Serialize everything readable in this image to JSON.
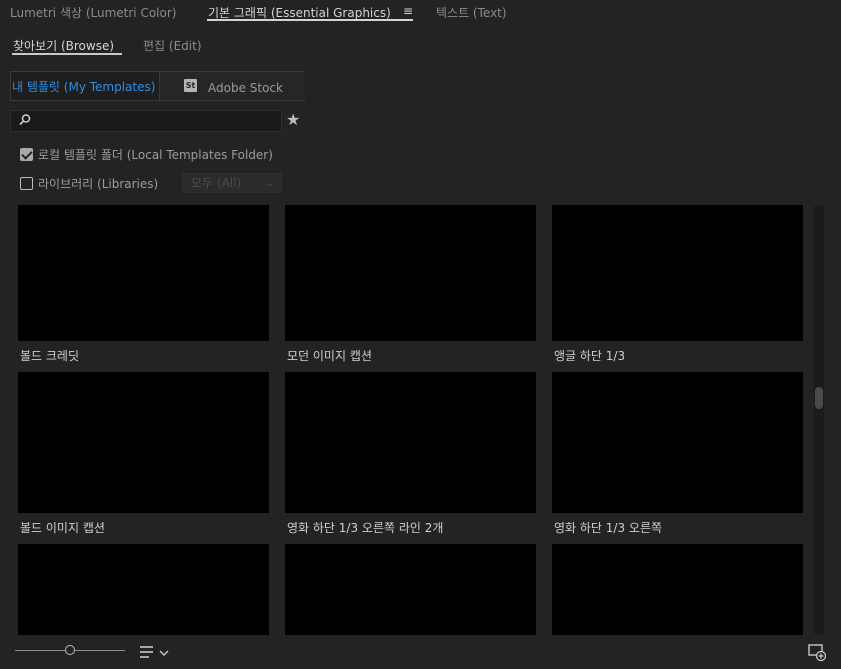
{
  "panel_tabs": [
    {
      "label": "Lumetri 색상 (Lumetri Color)",
      "active": false
    },
    {
      "label": "기본 그래픽 (Essential Graphics)",
      "active": true
    },
    {
      "label": "텍스트 (Text)",
      "active": false
    }
  ],
  "panel_menu_icon": "hamburger-menu-icon",
  "sub_tabs": [
    {
      "label": "찾아보기 (Browse)",
      "active": true
    },
    {
      "label": "편집 (Edit)",
      "active": false
    }
  ],
  "source_toggle": {
    "my_templates": "내 템플릿 (My Templates)",
    "stock_badge": "St",
    "adobe_stock": "Adobe Stock",
    "selected": "my_templates"
  },
  "search": {
    "placeholder": "",
    "value": "",
    "icon": "search-icon",
    "favorite_icon": "star-icon"
  },
  "filters": {
    "local_templates_label": "로컬 템플릿 폴더 (Local Templates Folder)",
    "local_templates_checked": true,
    "libraries_label": "라이브러리 (Libraries)",
    "libraries_checked": false,
    "libraries_dropdown_value": "모두 (All)"
  },
  "templates": [
    {
      "label": "볼드 크레딧"
    },
    {
      "label": "모던 이미지 캡션"
    },
    {
      "label": "앵글 하단 1/3"
    },
    {
      "label": "볼드 이미지 캡션"
    },
    {
      "label": "영화 하단 1/3 오른쪽 라인 2개"
    },
    {
      "label": "영화 하단 1/3 오른쪽"
    },
    {
      "label": ""
    },
    {
      "label": ""
    },
    {
      "label": ""
    }
  ],
  "scroll_position": 0.45,
  "zoom_slider_value": 0.5,
  "bottom_icons": {
    "list_view": "list-view-icon",
    "new_item": "new-item-icon"
  },
  "colors": {
    "accent": "#2f8ee0",
    "background": "#232323",
    "thumbnail": "#000000"
  }
}
